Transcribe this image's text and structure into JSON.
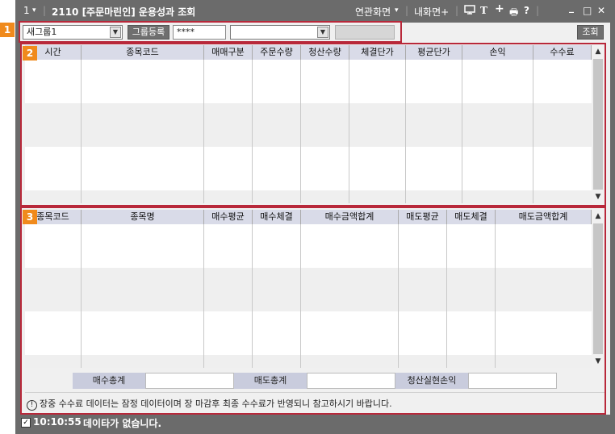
{
  "window": {
    "menu_number": "1",
    "title": "2110 [주문마린인] 운용성과 조회",
    "related_screen": "연관화면",
    "my_screen": "내화면+",
    "icon_glyphs": {
      "print": "🖶",
      "help": "?",
      "text": "T",
      "plus": "+",
      "minimize": "_",
      "maximize": "□",
      "close": "✕"
    }
  },
  "toolbar": {
    "group_select": "새그룹1",
    "group_register_label": "그룹등록",
    "password_value": "****",
    "account_select": "",
    "account_name": "",
    "query_label": "조회"
  },
  "badges": [
    "1",
    "2",
    "3"
  ],
  "grid_top": {
    "columns": [
      "시간",
      "종목코드",
      "매매구분",
      "주문수량",
      "청산수량",
      "체결단가",
      "평균단가",
      "손익",
      "수수료"
    ],
    "rows": []
  },
  "grid_bottom": {
    "columns": [
      "종목코드",
      "종목명",
      "매수평균",
      "매수체결",
      "매수금액합계",
      "매도평균",
      "매도체결",
      "매도금액합계"
    ],
    "rows": []
  },
  "totals": {
    "buy_total_label": "매수총계",
    "buy_total_value": "",
    "sell_total_label": "매도총계",
    "sell_total_value": "",
    "realized_pl_label": "청산실현손익",
    "realized_pl_value": ""
  },
  "notice": "장중 수수료 데이터는 잠정 데이터이며 장 마감후 최종 수수료가 반영되니 참고하시기 바랍니다.",
  "status": {
    "time": "10:10:55",
    "message": "데이타가 없습니다."
  }
}
